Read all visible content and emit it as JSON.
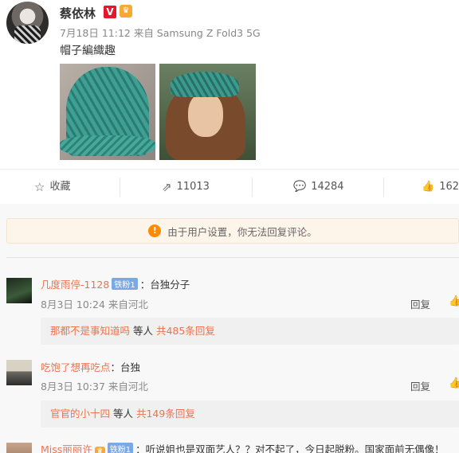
{
  "post": {
    "username": "蔡依林",
    "verified_badge": "V",
    "meta": "7月18日 11:12 来自 Samsung Z Fold3 5G",
    "text": "帽子編織趣"
  },
  "actions": [
    {
      "icon": "star-outline-icon",
      "glyph": "☆",
      "label": "收藏"
    },
    {
      "icon": "share-icon",
      "glyph": "⇗",
      "label": "11013"
    },
    {
      "icon": "comment-icon",
      "glyph": "💬",
      "label": "14284"
    },
    {
      "icon": "thumbs-up-icon",
      "glyph": "👍",
      "label": "162"
    }
  ],
  "notice": {
    "icon": "warning-icon",
    "text": "由于用户设置，你无法回复评论。"
  },
  "comments": [
    {
      "name": "几度雨停-1128",
      "vip": "铁粉1",
      "text": "：台独分子",
      "meta": "8月3日 10:24 来自河北",
      "reply": "回复",
      "sub_name": "那都不是事知道吗",
      "sub_mid": " 等人 ",
      "sub_count": "共485条回复"
    },
    {
      "name": "吃饱了想再吃点",
      "text": "：台独",
      "meta": "8月3日 10:37 来自河北",
      "reply": "回复",
      "sub_name": "官官的小十四",
      "sub_mid": " 等人 ",
      "sub_count": "共149条回复"
    },
    {
      "name": "Miss丽丽许",
      "vip": "铁粉1",
      "text": "：听说姐也是双面艺人？？对不起了，今日起脱粉。国家面前无偶像！"
    }
  ],
  "colors": {
    "accent": "#eb7350",
    "notice_icon": "#ff8a00",
    "vip": "#7aa9e6"
  }
}
